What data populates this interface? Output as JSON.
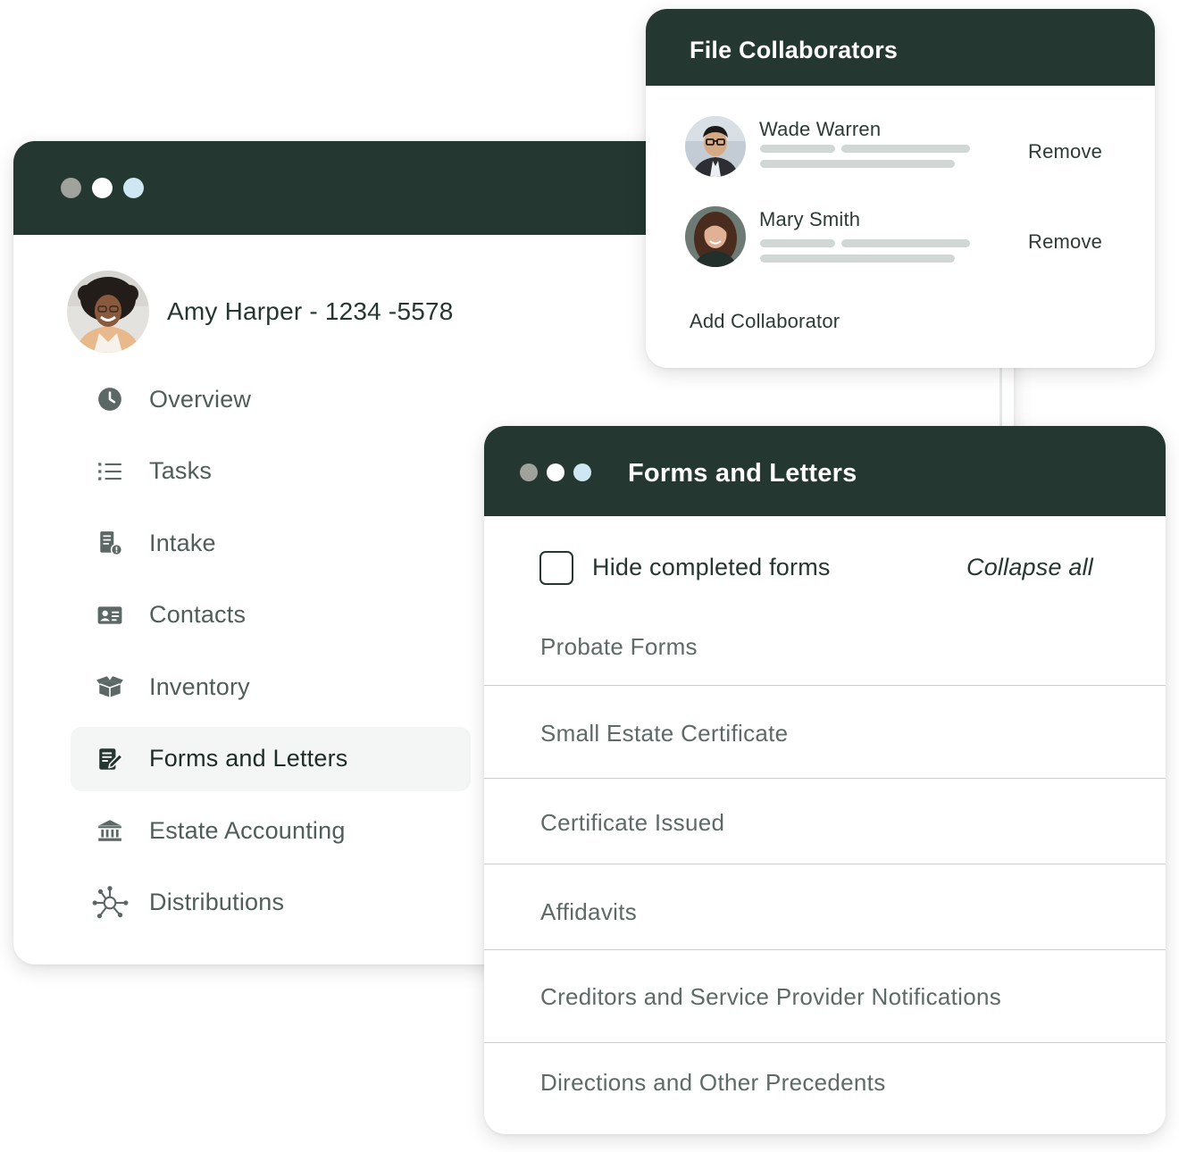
{
  "window_dots": [
    "#a0a39d",
    "#ffffff",
    "#cfe6f3"
  ],
  "colors": {
    "header_bg": "#243731",
    "active_nav_bg": "#f4f6f6"
  },
  "profile": {
    "name": "Amy Harper - 1234 -5578"
  },
  "nav": {
    "items": [
      {
        "label": "Overview",
        "icon": "clock-icon",
        "active": false
      },
      {
        "label": "Tasks",
        "icon": "list-icon",
        "active": false
      },
      {
        "label": "Intake",
        "icon": "intake-document-icon",
        "active": false
      },
      {
        "label": "Contacts",
        "icon": "contact-card-icon",
        "active": false
      },
      {
        "label": "Inventory",
        "icon": "box-icon",
        "active": false
      },
      {
        "label": "Forms and Letters",
        "icon": "edit-form-icon",
        "active": true
      },
      {
        "label": "Estate Accounting",
        "icon": "bank-icon",
        "active": false
      },
      {
        "label": "Distributions",
        "icon": "network-icon",
        "active": false
      }
    ]
  },
  "collaborators": {
    "title": "File Collaborators",
    "people": [
      {
        "name": "Wade Warren",
        "action": "Remove"
      },
      {
        "name": "Mary Smith",
        "action": "Remove"
      }
    ],
    "add_label": "Add Collaborator"
  },
  "forms": {
    "title": "Forms and Letters",
    "hide_completed_label": "Hide completed forms",
    "hide_completed_checked": false,
    "collapse_label": "Collapse all",
    "sections": [
      "Probate Forms",
      "Small Estate Certificate",
      "Certificate Issued",
      "Affidavits",
      "Creditors and Service Provider Notifications",
      "Directions and Other Precedents"
    ]
  }
}
